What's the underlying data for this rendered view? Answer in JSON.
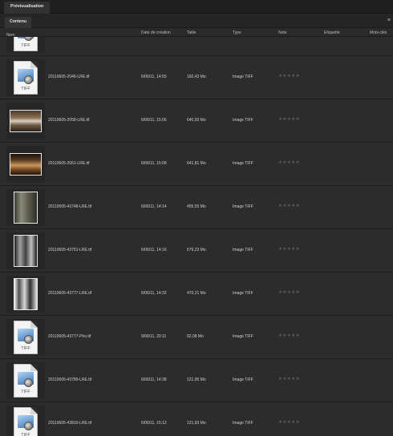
{
  "tabs": {
    "preview": "Prévisualisation"
  },
  "panel": {
    "tab": "Contenu",
    "menu_icon": "≡"
  },
  "columns": {
    "name": "Nom",
    "sort_arrow": "↑",
    "created": "Date de création",
    "size": "Taille",
    "type": "Type",
    "rating": "Note",
    "label": "Etiquette",
    "keywords": "Mots-clés"
  },
  "thumb_text": "TIFF",
  "stars_glyph": "★★★★★",
  "files": [
    {
      "name": "20110605-2046-LRE.tif",
      "created": "6/06/11, 14:55",
      "size": "160,43 Mo",
      "type": "Image TIFF",
      "thumb": "tif-icon"
    },
    {
      "name": "20110605-2058-LRE.tif",
      "created": "6/06/11, 15:06",
      "size": "640,93 Mo",
      "type": "Image TIFF",
      "thumb": "photo-landscape"
    },
    {
      "name": "20110605-2061-LRE.tif",
      "created": "6/06/11, 15:08",
      "size": "641,81 Mo",
      "type": "Image TIFF",
      "thumb": "photo-landscape"
    },
    {
      "name": "20110605-43748-LRE.tif",
      "created": "6/06/11, 14:14",
      "size": "455,55 Mo",
      "type": "Image TIFF",
      "thumb": "photo-portrait"
    },
    {
      "name": "20110605-43751-LRE.tif",
      "created": "6/06/11, 14:16",
      "size": "579,23 Mo",
      "type": "Image TIFF",
      "thumb": "photo-portrait"
    },
    {
      "name": "20110605-43777-LRE.tif",
      "created": "6/06/11, 14:32",
      "size": "470,21 Mo",
      "type": "Image TIFF",
      "thumb": "photo-portrait"
    },
    {
      "name": "20110605-43777-Pho.tif",
      "created": "9/06/11, 20:11",
      "size": "92,08 Mo",
      "type": "Image TIFF",
      "thumb": "tif-icon"
    },
    {
      "name": "20110605-43789-LRE.tif",
      "created": "6/06/11, 14:38",
      "size": "121,95 Mo",
      "type": "Image TIFF",
      "thumb": "tif-icon"
    },
    {
      "name": "20110605-43810-LRE.tif",
      "created": "6/06/11, 15:12",
      "size": "121,93 Mo",
      "type": "Image TIFF",
      "thumb": "tif-icon"
    }
  ]
}
